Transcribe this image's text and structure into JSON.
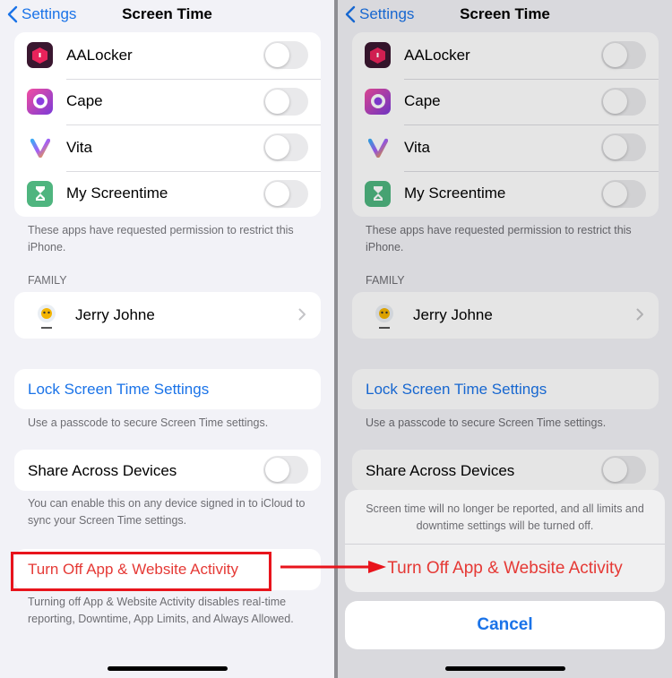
{
  "nav": {
    "back_label": "Settings",
    "title": "Screen Time"
  },
  "apps": [
    {
      "name": "AALocker",
      "icon": "aalocker-icon",
      "enabled": false
    },
    {
      "name": "Cape",
      "icon": "cape-icon",
      "enabled": false
    },
    {
      "name": "Vita",
      "icon": "vita-icon",
      "enabled": false
    },
    {
      "name": "My Screentime",
      "icon": "hourglass-icon",
      "enabled": false
    }
  ],
  "apps_footnote": "These apps have requested permission to restrict this iPhone.",
  "family": {
    "header": "FAMILY",
    "member_name": "Jerry Johne"
  },
  "lock": {
    "label": "Lock Screen Time Settings",
    "footnote": "Use a passcode to secure Screen Time settings."
  },
  "share": {
    "label": "Share Across Devices",
    "enabled": false,
    "footnote": "You can enable this on any device signed in to iCloud to sync your Screen Time settings."
  },
  "turn_off": {
    "label": "Turn Off App & Website Activity",
    "footnote": "Turning off App & Website Activity disables real-time reporting, Downtime, App Limits, and Always Allowed."
  },
  "action_sheet": {
    "message": "Screen time will no longer be reported, and all limits and downtime settings will be turned off.",
    "action_label": "Turn Off App & Website Activity",
    "cancel_label": "Cancel"
  },
  "colors": {
    "link": "#1a73e8",
    "destructive": "#e53935",
    "annotation": "#e8141c"
  }
}
